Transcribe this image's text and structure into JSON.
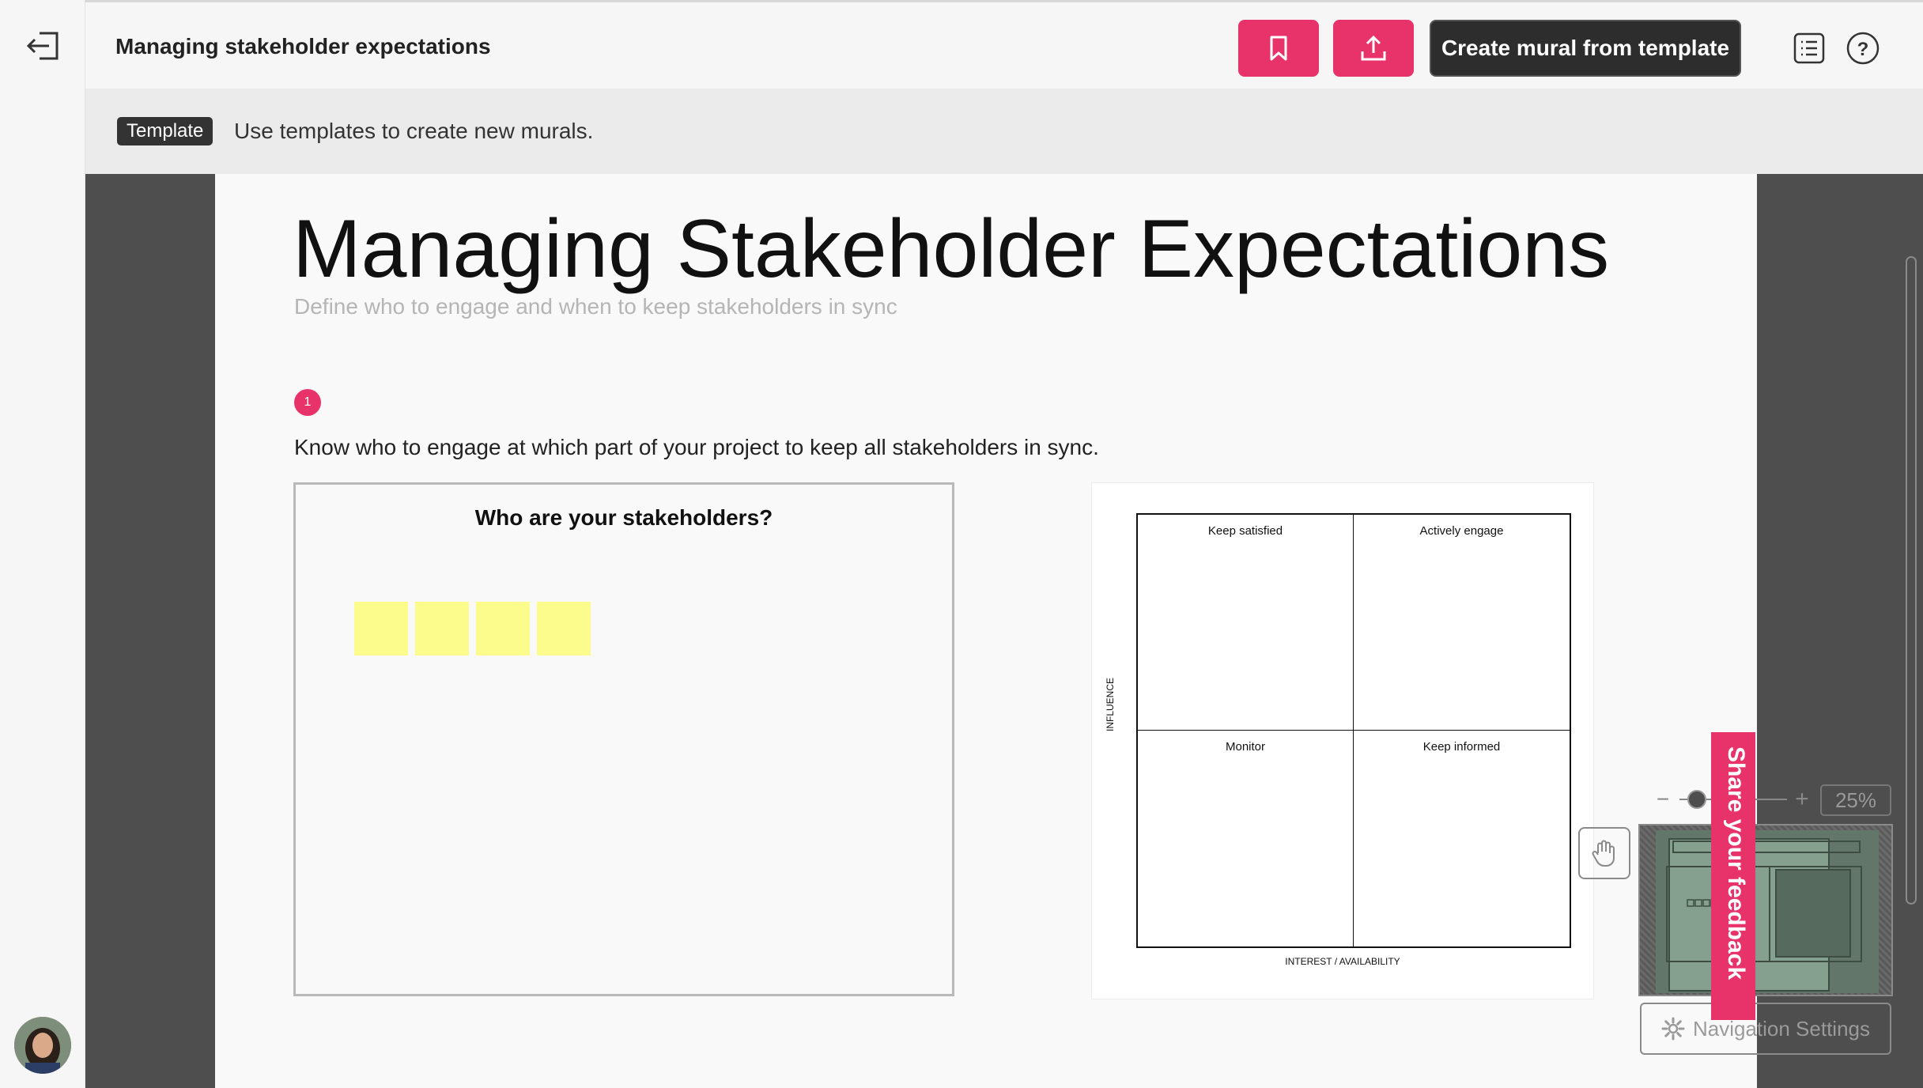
{
  "app": {
    "doc_title": "Managing stakeholder expectations",
    "exit_icon": "exit-icon",
    "bookmark_icon": "bookmark-icon",
    "share_icon": "upload-icon",
    "create_button": "Create mural from template",
    "outline_icon": "outline-list-icon",
    "help_icon": "help-icon",
    "accent_color": "#e8336a"
  },
  "infobar": {
    "badge": "Template",
    "text": "Use templates to create new murals."
  },
  "board": {
    "title": "Managing Stakeholder Expectations",
    "subtitle": "Define who to engage and when to keep stakeholders in sync",
    "step_number": "1",
    "step_text": "Know who to engage at which part of your project to keep all stakeholders in sync.",
    "stakeholders_title": "Who are your stakeholders?",
    "sticky_count": 4,
    "sticky_color": "#fbfc8c",
    "matrix": {
      "top_left": "Keep satisfied",
      "top_right": "Actively engage",
      "bottom_left": "Monitor",
      "bottom_right": "Keep informed",
      "y_axis": "INFLUENCE",
      "x_axis": "INTEREST / AVAILABILITY"
    }
  },
  "controls": {
    "zoom_minus": "−",
    "zoom_plus": "+",
    "zoom_level": "25%",
    "hand_icon": "hand-icon",
    "nav_settings": "Navigation Settings",
    "gear_icon": "gear-icon",
    "feedback": "Share your feedback"
  }
}
